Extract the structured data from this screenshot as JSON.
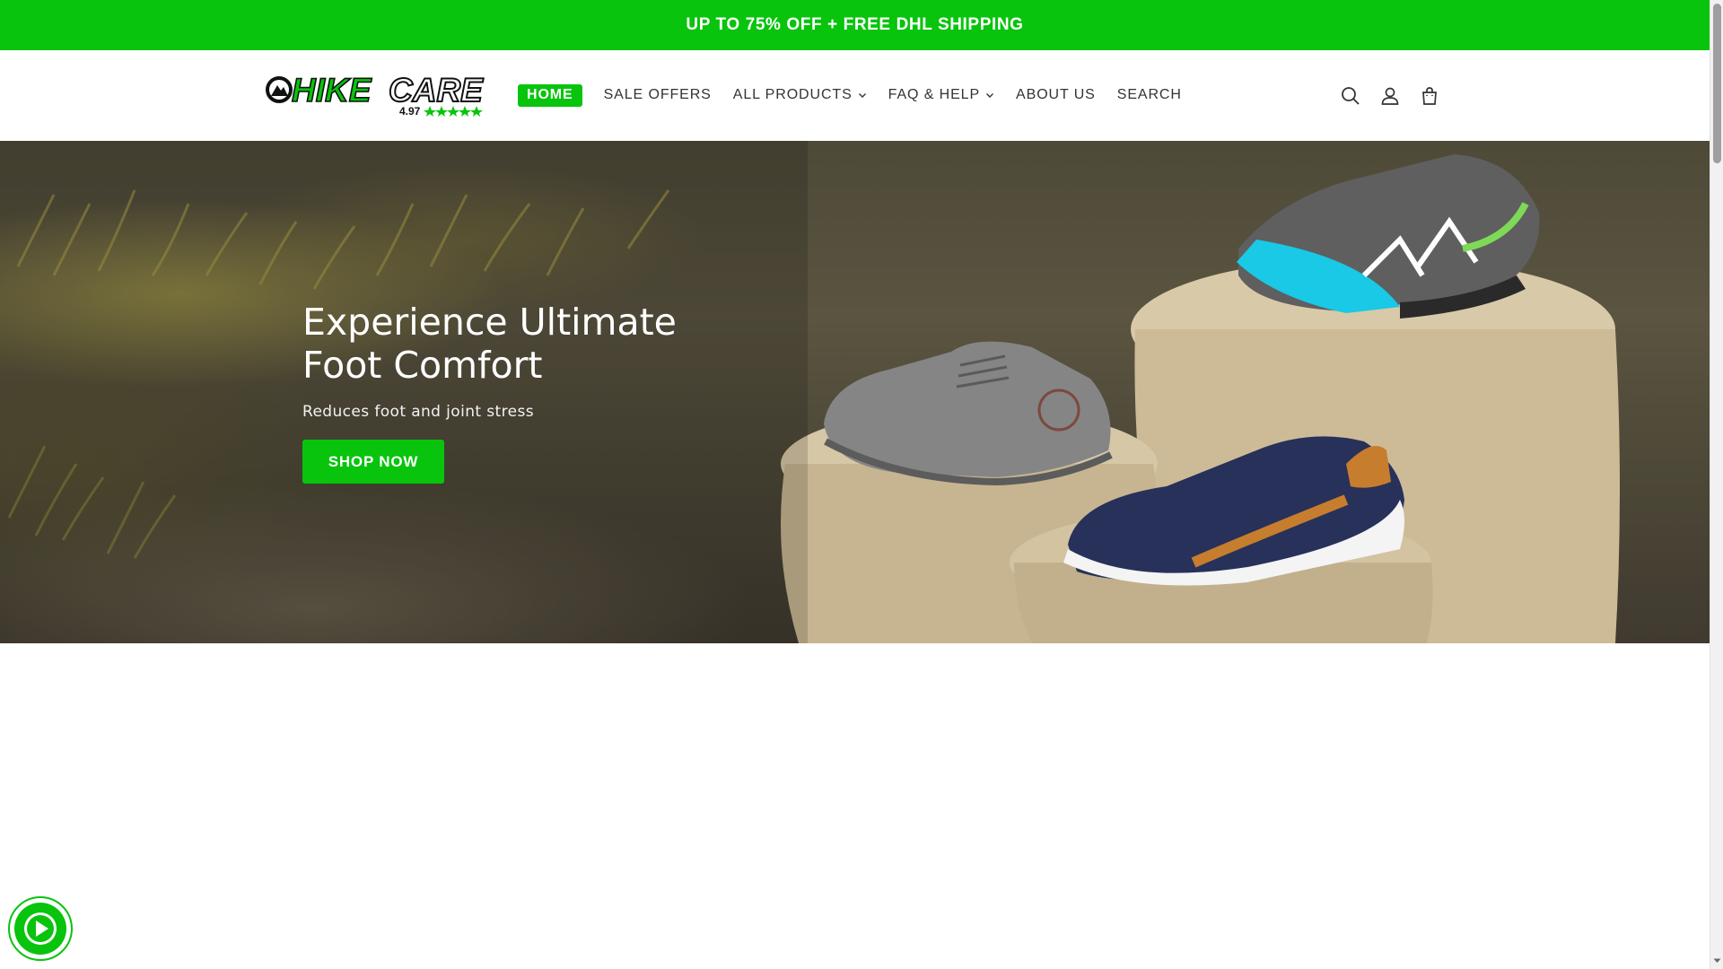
{
  "announcement": {
    "text": "UP TO 75% OFF + FREE DHL SHIPPING"
  },
  "logo": {
    "text_left": "HIKE",
    "text_right": "CARE",
    "rating": "4.97"
  },
  "nav": {
    "items": [
      {
        "label": "HOME",
        "active": true,
        "dropdown": false
      },
      {
        "label": "SALE OFFERS",
        "active": false,
        "dropdown": false
      },
      {
        "label": "ALL PRODUCTS",
        "active": false,
        "dropdown": true
      },
      {
        "label": "FAQ & HELP",
        "active": false,
        "dropdown": true
      },
      {
        "label": "ABOUT US",
        "active": false,
        "dropdown": false
      },
      {
        "label": "SEARCH",
        "active": false,
        "dropdown": false
      }
    ]
  },
  "header_icons": [
    "search-icon",
    "account-icon",
    "cart-icon"
  ],
  "hero": {
    "title_line1": "Experience Ultimate",
    "title_line2": "Foot Comfort",
    "subtitle": "Reduces foot and joint stress",
    "cta_label": "SHOP NOW"
  },
  "colors": {
    "brand_green": "#08c40d",
    "text_dark": "#333333"
  },
  "floating_widget": {
    "icon": "play-icon"
  }
}
